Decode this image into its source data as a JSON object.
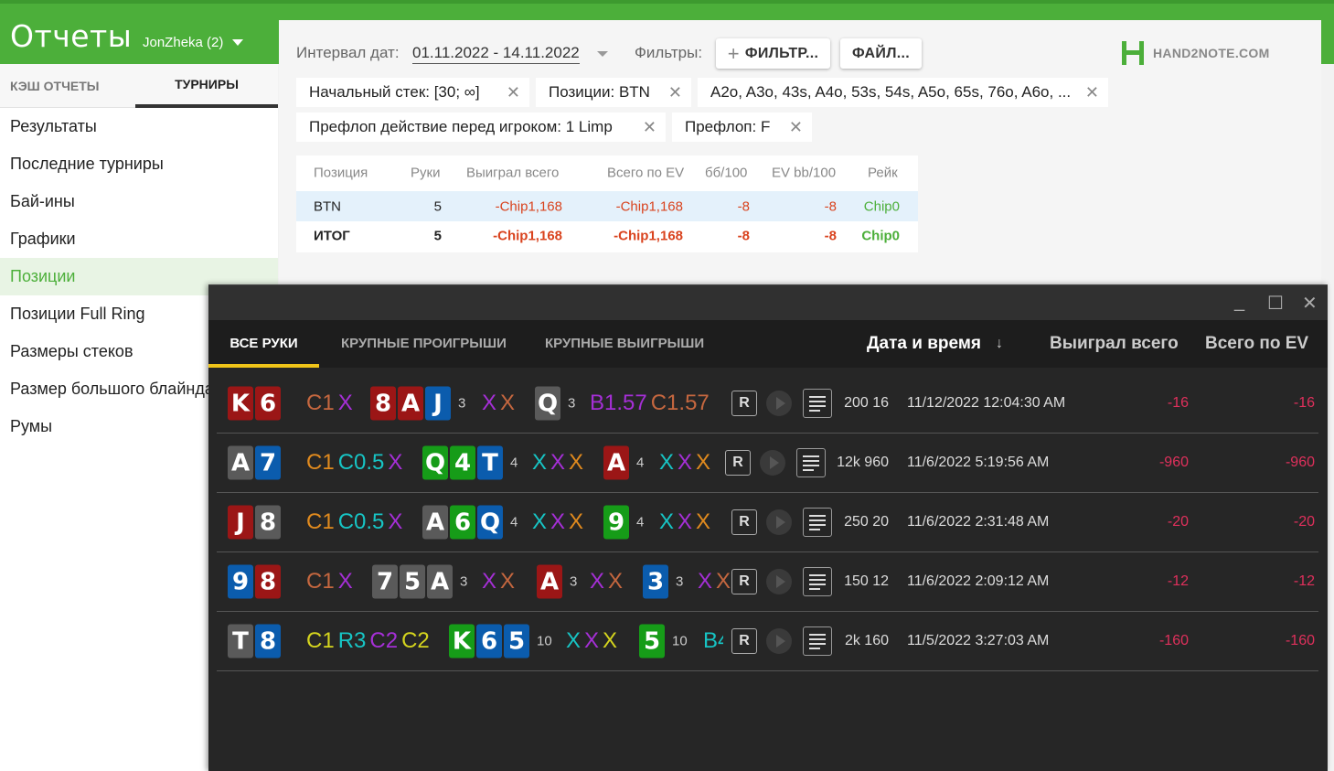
{
  "app": {
    "title": "Отчеты",
    "user": "JonZheka (2)"
  },
  "left_tabs": [
    "КЭШ ОТЧЕТЫ",
    "ТУРНИРЫ"
  ],
  "menu": [
    "Результаты",
    "Последние турниры",
    "Бай-ины",
    "Графики",
    "Позиции",
    "Позиции Full Ring",
    "Размеры стеков",
    "Размер большого блайнда",
    "Румы"
  ],
  "filters": {
    "date_label": "Интервал дат:",
    "date_value": "01.11.2022 - 14.11.2022",
    "filters_label": "Фильтры:",
    "add_filter": "ФИЛЬТР...",
    "file_btn": "ФАЙЛ...",
    "logo": "HAND2NOTE.COM",
    "chips": [
      "Начальный стек: [30; ∞]",
      "Позиции: BTN",
      "A2o, A3o, 43s, A4o, 53s, 54s, A5o, 65s, 76o, A6o, ...",
      "Префлоп действие перед игроком: 1 Limp",
      "Префлоп: F"
    ]
  },
  "stats": {
    "headers": [
      "Позиция",
      "Руки",
      "Выиграл всего",
      "Всего по EV",
      "бб/100",
      "EV bb/100",
      "Рейк"
    ],
    "rows": [
      [
        "BTN",
        "5",
        "-Chip1,168",
        "-Chip1,168",
        "-8",
        "-8",
        "Chip0"
      ],
      [
        "ИТОГ",
        "5",
        "-Chip1,168",
        "-Chip1,168",
        "-8",
        "-8",
        "Chip0"
      ]
    ]
  },
  "hands_window": {
    "tabs": [
      "ВСЕ РУКИ",
      "КРУПНЫЕ ПРОИГРЫШИ",
      "КРУПНЫЕ ВЫИГРЫШИ"
    ],
    "cols": [
      "Дата и время",
      "↓",
      "Выиграл всего",
      "Всего по EV"
    ],
    "controls": {
      "minimize": "_",
      "maximize": "☐",
      "close": "✕"
    },
    "r_label": "R",
    "colors": {
      "spade": "#5a5a5a",
      "heart": "#9b1616",
      "diamond": "#0b5cad",
      "club": "#169c18"
    },
    "rows": [
      {
        "hole": [
          [
            "K",
            "heart"
          ],
          [
            "6",
            "heart"
          ]
        ],
        "pre": [
          [
            "C1",
            "#c5673f"
          ],
          [
            "X",
            "#a52fd6"
          ]
        ],
        "flop": [
          [
            "8",
            "heart"
          ],
          [
            "A",
            "heart"
          ],
          [
            "J",
            "diamond"
          ]
        ],
        "flop_n": "3",
        "flop_act": [
          [
            "X",
            "#a52fd6"
          ],
          [
            "X",
            "#c5673f"
          ]
        ],
        "turn": [
          [
            "Q",
            "spade"
          ]
        ],
        "turn_n": "3",
        "turn_act": [
          [
            "B1.57",
            "#a52fd6"
          ],
          [
            "C1.57",
            "#c5673f"
          ]
        ],
        "river": [],
        "river_n": "",
        "river_act": [],
        "stakes": "200 16",
        "date": "11/12/2022 12:04:30 AM",
        "won": "-16",
        "ev": "-16"
      },
      {
        "hole": [
          [
            "A",
            "spade"
          ],
          [
            "7",
            "diamond"
          ]
        ],
        "pre": [
          [
            "C1",
            "#e08a1e"
          ],
          [
            "C0.5",
            "#17c4c4"
          ],
          [
            "X",
            "#a52fd6"
          ]
        ],
        "flop": [
          [
            "Q",
            "club"
          ],
          [
            "4",
            "club"
          ],
          [
            "T",
            "diamond"
          ]
        ],
        "flop_n": "4",
        "flop_act": [
          [
            "X",
            "#17c4c4"
          ],
          [
            "X",
            "#a52fd6"
          ],
          [
            "X",
            "#e08a1e"
          ]
        ],
        "turn": [
          [
            "A",
            "heart"
          ]
        ],
        "turn_n": "4",
        "turn_act": [
          [
            "X",
            "#17c4c4"
          ],
          [
            "X",
            "#a52fd6"
          ],
          [
            "X",
            "#e08a1e"
          ]
        ],
        "river": [],
        "river_n": "",
        "river_act": [],
        "stakes": "12k 960",
        "date": "11/6/2022 5:19:56 AM",
        "won": "-960",
        "ev": "-960"
      },
      {
        "hole": [
          [
            "J",
            "heart"
          ],
          [
            "8",
            "spade"
          ]
        ],
        "pre": [
          [
            "C1",
            "#e08a1e"
          ],
          [
            "C0.5",
            "#17c4c4"
          ],
          [
            "X",
            "#a52fd6"
          ]
        ],
        "flop": [
          [
            "A",
            "spade"
          ],
          [
            "6",
            "club"
          ],
          [
            "Q",
            "diamond"
          ]
        ],
        "flop_n": "4",
        "flop_act": [
          [
            "X",
            "#17c4c4"
          ],
          [
            "X",
            "#a52fd6"
          ],
          [
            "X",
            "#e08a1e"
          ]
        ],
        "turn": [
          [
            "9",
            "club"
          ]
        ],
        "turn_n": "4",
        "turn_act": [
          [
            "X",
            "#17c4c4"
          ],
          [
            "X",
            "#a52fd6"
          ],
          [
            "X",
            "#e08a1e"
          ]
        ],
        "river": [],
        "river_n": "",
        "river_act": [],
        "stakes": "250 20",
        "date": "11/6/2022 2:31:48 AM",
        "won": "-20",
        "ev": "-20"
      },
      {
        "hole": [
          [
            "9",
            "diamond"
          ],
          [
            "8",
            "heart"
          ]
        ],
        "pre": [
          [
            "C1",
            "#c5673f"
          ],
          [
            "X",
            "#a52fd6"
          ]
        ],
        "flop": [
          [
            "7",
            "spade"
          ],
          [
            "5",
            "spade"
          ],
          [
            "A",
            "spade"
          ]
        ],
        "flop_n": "3",
        "flop_act": [
          [
            "X",
            "#a52fd6"
          ],
          [
            "X",
            "#c5673f"
          ]
        ],
        "turn": [
          [
            "A",
            "heart"
          ]
        ],
        "turn_n": "3",
        "turn_act": [
          [
            "X",
            "#a52fd6"
          ],
          [
            "X",
            "#c5673f"
          ]
        ],
        "river": [
          [
            "3",
            "diamond"
          ]
        ],
        "river_n": "3",
        "river_act": [
          [
            "X",
            "#a52fd6"
          ],
          [
            "X",
            "#c5673f"
          ]
        ],
        "stakes": "150 12",
        "date": "11/6/2022 2:09:12 AM",
        "won": "-12",
        "ev": "-12"
      },
      {
        "hole": [
          [
            "T",
            "spade"
          ],
          [
            "8",
            "diamond"
          ]
        ],
        "pre": [
          [
            "C1",
            "#d4d41e"
          ],
          [
            "R3",
            "#17c4c4"
          ],
          [
            "C2",
            "#a52fd6"
          ],
          [
            "C2",
            "#d4d41e"
          ]
        ],
        "flop": [
          [
            "K",
            "club"
          ],
          [
            "6",
            "diamond"
          ],
          [
            "5",
            "diamond"
          ]
        ],
        "flop_n": "10",
        "flop_act": [
          [
            "X",
            "#17c4c4"
          ],
          [
            "X",
            "#a52fd6"
          ],
          [
            "X",
            "#d4d41e"
          ]
        ],
        "turn": [
          [
            "5",
            "club"
          ]
        ],
        "turn_n": "10",
        "turn_act": [
          [
            "B4",
            "#17c4c4"
          ]
        ],
        "river": [],
        "river_n": "",
        "river_act": [],
        "stakes": "2k 160",
        "date": "11/5/2022 3:27:03 AM",
        "won": "-160",
        "ev": "-160"
      }
    ]
  }
}
